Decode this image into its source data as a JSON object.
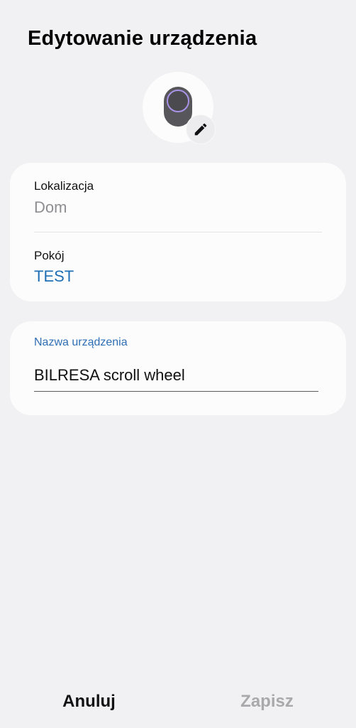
{
  "header": {
    "title": "Edytowanie urządzenia"
  },
  "device": {
    "icon": "scroll-wheel-device-icon",
    "edit_icon": "pencil-icon",
    "accent_color": "#a893e8"
  },
  "location_card": {
    "location_label": "Lokalizacja",
    "location_value": "Dom",
    "room_label": "Pokój",
    "room_value": "TEST",
    "room_value_color": "#1f6fb4"
  },
  "name_card": {
    "label": "Nazwa urządzenia",
    "value": "BILRESA scroll wheel"
  },
  "actions": {
    "cancel_label": "Anuluj",
    "save_label": "Zapisz",
    "save_enabled": false
  }
}
